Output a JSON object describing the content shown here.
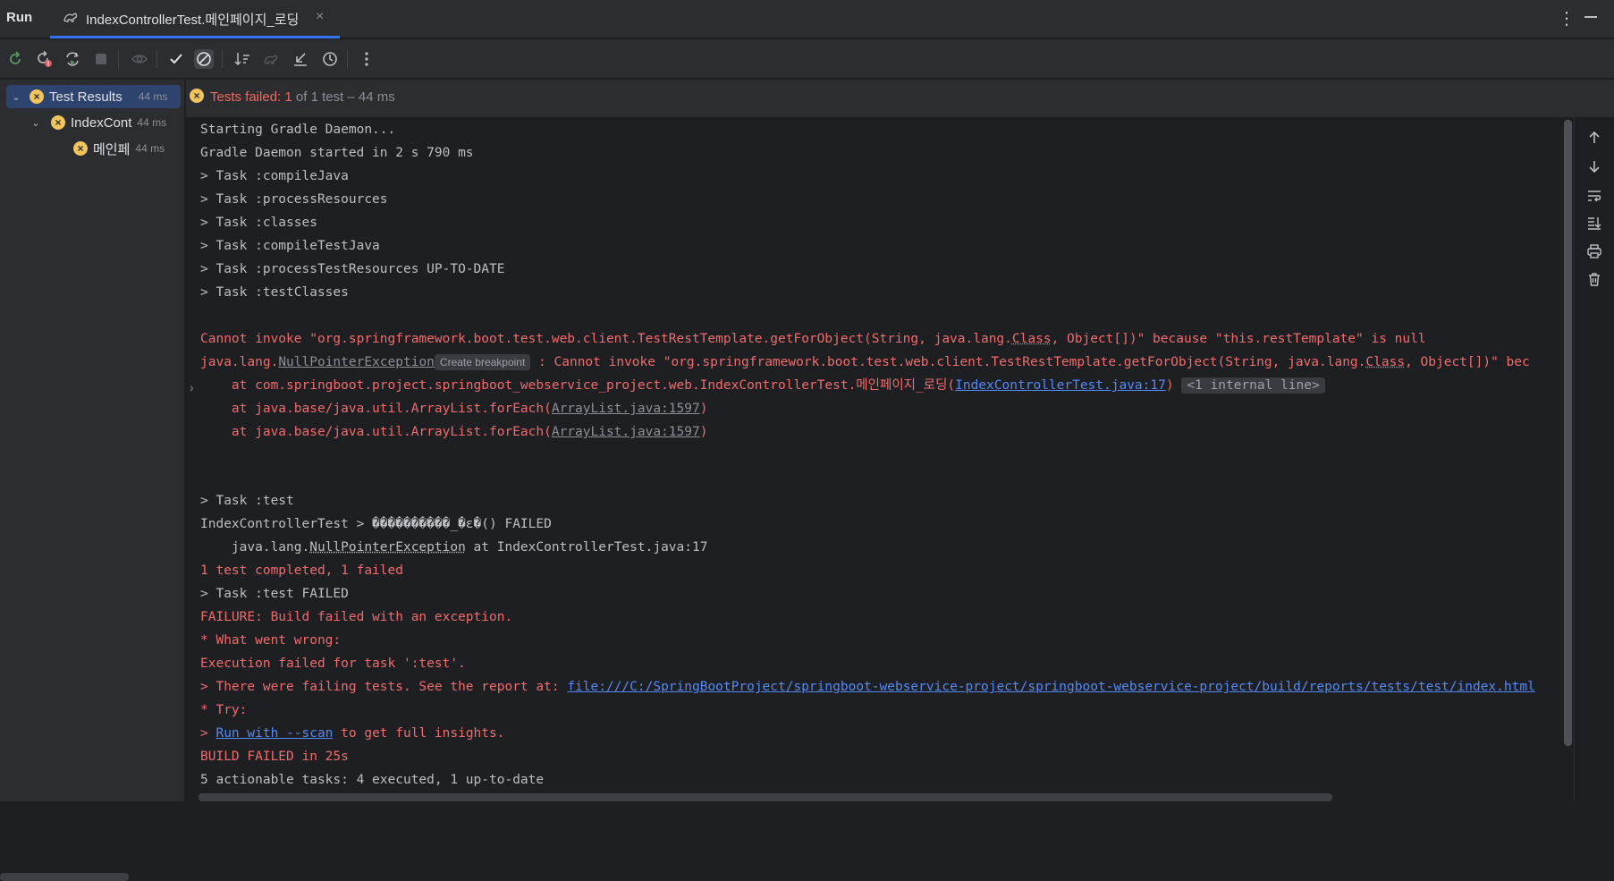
{
  "header": {
    "run_label": "Run",
    "tab_title": "IndexControllerTest.메인페이지_로딩",
    "tab_close": "×",
    "more": "⋮"
  },
  "toolbar": {
    "buttons": [
      "rerun-icon",
      "rerun-failed-icon",
      "toggle-auto-test-icon",
      "stop-icon",
      "show-passed-icon",
      "show-ignored-icon",
      "sort-icon",
      "import-tests-icon",
      "export-tests-icon",
      "history-icon",
      "more-icon"
    ]
  },
  "tree": {
    "root": {
      "label": "Test Results",
      "time": "44 ms"
    },
    "class": {
      "label": "IndexCont",
      "time": "44 ms"
    },
    "method": {
      "label": "메인페",
      "time": "44 ms"
    }
  },
  "status": {
    "failed_label": "Tests failed: 1",
    "summary": " of 1 test – 44 ms"
  },
  "console": {
    "l1": "Starting Gradle Daemon...",
    "l2": "Gradle Daemon started in 2 s 790 ms",
    "l3": "> Task :compileJava",
    "l4": "> Task :processResources",
    "l5": "> Task :classes",
    "l6": "> Task :compileTestJava",
    "l7": "> Task :processTestResources UP-TO-DATE",
    "l8": "> Task :testClasses",
    "e1a": "Cannot invoke \"org.springframework.boot.test.web.client.TestRestTemplate.getForObject(String, java.lang.",
    "e1b": "Class",
    "e1c": ", Object[])\" because \"this.restTemplate\" is null",
    "e2a": "java.lang.",
    "e2b": "NullPointerException",
    "e2chip": "Create breakpoint",
    "e2c": " : Cannot invoke \"org.springframework.boot.test.web.client.TestRestTemplate.getForObject(String, java.lang.",
    "e2d": "Class",
    "e2e": ", Object[])\" bec",
    "e3a": "    at com.springboot.project.springboot_webservice_project.web.IndexControllerTest.메인페이지_로딩(",
    "e3link": "IndexControllerTest.java:17",
    "e3b": ")",
    "e3chip": "<1 internal line>",
    "e4a": "    at java.base/java.util.ArrayList.forEach(",
    "e4link": "ArrayList.java:1597",
    "e4b": ")",
    "e5a": "    at java.base/java.util.ArrayList.forEach(",
    "e5link": "ArrayList.java:1597",
    "e5b": ")",
    "t1": "> Task :test",
    "t2": "IndexControllerTest > ����������_�ε�() FAILED",
    "t3a": "    java.lang.",
    "t3b": "NullPointerException",
    "t3c": " at IndexControllerTest.java:17",
    "t4": "1 test completed, 1 failed",
    "t5": "> Task :test FAILED",
    "f1": "FAILURE: Build failed with an exception.",
    "f2": "* What went wrong:",
    "f3": "Execution failed for task ':test'.",
    "f4a": "> There were failing tests. See the report at: ",
    "f4link": "file:///C:/SpringBootProject/springboot-webservice-project/springboot-webservice-project/build/reports/tests/test/index.html",
    "f5": "* Try:",
    "f6a": "> ",
    "f6link": "Run with --scan",
    "f6b": " to get full insights.",
    "f7": "BUILD FAILED in 25s",
    "f8": "5 actionable tasks: 4 executed, 1 up-to-date"
  },
  "colors": {
    "background": "#1e1f22",
    "panel": "#2b2d30",
    "error_text": "#f16b6b",
    "link": "#548af7",
    "accent": "#3574f0",
    "warning_badge": "#f2c55c"
  }
}
